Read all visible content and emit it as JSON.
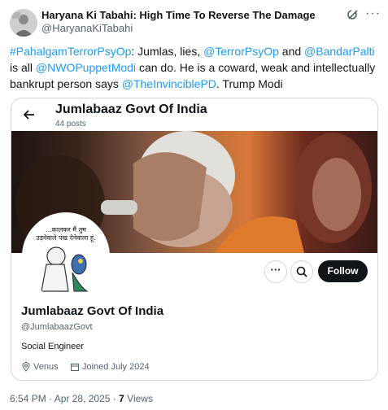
{
  "tweet": {
    "display_name": "Haryana Ki Tabahi: High Time To Reverse The Damage",
    "handle": "@HaryanaKiTabahi",
    "text_segments": [
      {
        "text": "#PahalgamTerrorPsyOp",
        "link": true
      },
      {
        "text": ": Jumlas, lies, ",
        "link": false
      },
      {
        "text": "@TerrorPsyOp",
        "link": true
      },
      {
        "text": " and ",
        "link": false
      },
      {
        "text": "@BandarPalti",
        "link": true
      },
      {
        "text": " is all ",
        "link": false
      },
      {
        "text": "@NWOPuppetModi",
        "link": true
      },
      {
        "text": " can do. He is a coward, weak and intellectually bankrupt person says ",
        "link": false
      },
      {
        "text": "@TheInvinciblePD",
        "link": true
      },
      {
        "text": ". Trump Modi",
        "link": false
      }
    ],
    "time": "6:54 PM",
    "separator": "·",
    "date": "Apr 28, 2025",
    "views_count": "7",
    "views_label": "Views"
  },
  "card": {
    "header_title": "Jumlabaaz Govt Of India",
    "posts_count": "44 posts",
    "avatar_caption_line1": "...कालकर मैं तुम",
    "avatar_caption_line2": "उड़नेवाले पंख देनेवाला हूं.",
    "follow_label": "Follow",
    "more_label": "···",
    "profile_name": "Jumlabaaz Govt Of India",
    "profile_handle": "@JumlabaazGovt",
    "bio": "Social Engineer",
    "location": "Venus",
    "joined": "Joined July 2024"
  },
  "colors": {
    "link": "#1d9bf0",
    "text": "#0f1419",
    "muted": "#536471",
    "border": "#cfd9de",
    "follow_bg": "#0f1419"
  },
  "icons": [
    "grok-icon",
    "more-icon",
    "back-arrow-icon",
    "search-icon",
    "location-icon",
    "calendar-icon"
  ]
}
